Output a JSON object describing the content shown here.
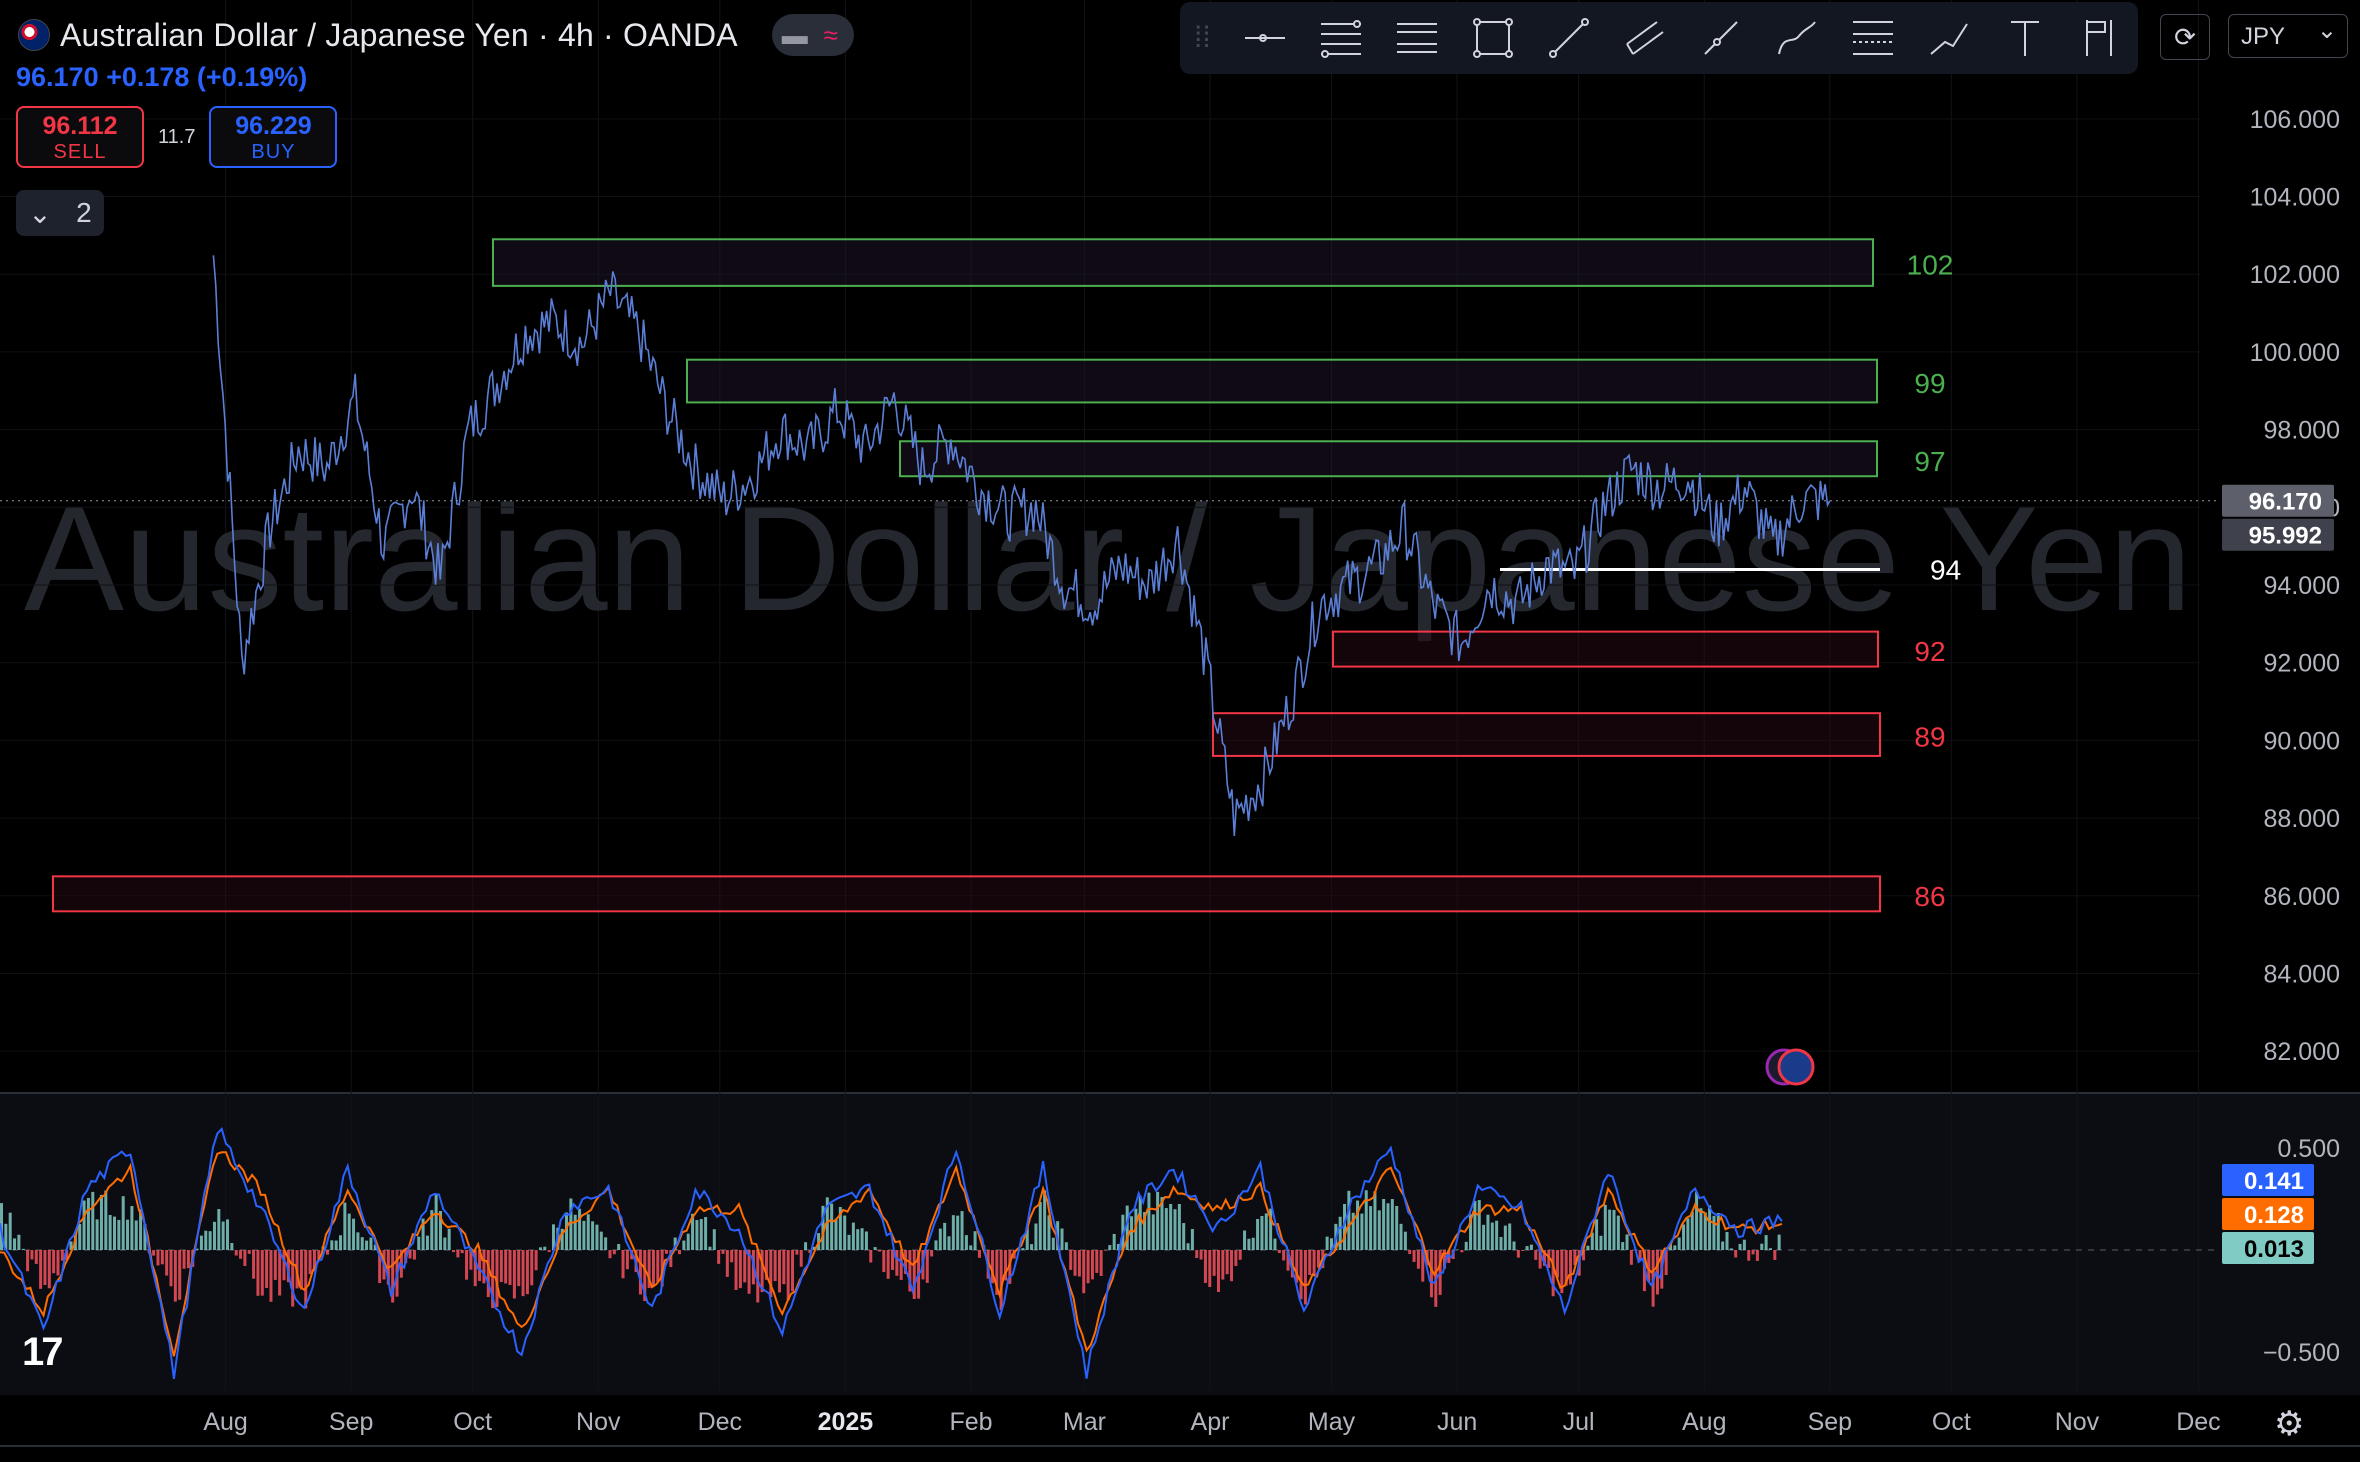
{
  "header": {
    "title": "Australian Dollar / Japanese Yen · 4h · OANDA",
    "quote": "96.170 +0.178 (+0.19%)",
    "sell_price": "96.112",
    "sell_label": "SELL",
    "spread": "11.7",
    "buy_price": "96.229",
    "buy_label": "BUY",
    "indicators_count": "2",
    "currency": "JPY"
  },
  "watermark": "Australian Dollar / Japanese Yen",
  "colors": {
    "price_line": "#5b7fd6",
    "supply_zone": "#4caf50",
    "demand_zone": "#f23645",
    "macd": "#2962ff",
    "signal": "#ff6d00",
    "hist_pos": "#80cbc4",
    "hist_neg": "#f7525f"
  },
  "chart_data": [
    {
      "type": "line",
      "title": "Australian Dollar / Japanese Yen · 4h · OANDA",
      "ylim": [
        81,
        107
      ],
      "y_ticks": [
        "106.000",
        "104.000",
        "102.000",
        "100.000",
        "98.000",
        "96.000",
        "94.000",
        "92.000",
        "90.000",
        "88.000",
        "86.000",
        "84.000",
        "82.000"
      ],
      "x_ticks": [
        "Aug",
        "Sep",
        "Oct",
        "Nov",
        "Dec",
        "2025",
        "Feb",
        "Mar",
        "Apr",
        "May",
        "Jun",
        "Jul",
        "Aug",
        "Sep",
        "Oct",
        "Nov",
        "Dec"
      ],
      "series": [
        {
          "x": [
            "2024-07-29",
            "2024-08-05",
            "2024-08-12",
            "2024-08-19",
            "2024-08-26",
            "2024-09-02",
            "2024-09-09",
            "2024-09-16",
            "2024-09-23",
            "2024-09-30",
            "2024-10-07",
            "2024-10-14",
            "2024-10-21",
            "2024-10-28",
            "2024-11-04",
            "2024-11-11",
            "2024-11-18",
            "2024-11-25",
            "2024-12-02",
            "2024-12-09",
            "2024-12-16",
            "2024-12-23",
            "2024-12-30",
            "2025-01-06",
            "2025-01-13",
            "2025-01-20",
            "2025-01-27",
            "2025-02-03",
            "2025-02-10",
            "2025-02-17",
            "2025-02-24",
            "2025-03-03",
            "2025-03-10",
            "2025-03-17",
            "2025-03-24",
            "2025-03-31",
            "2025-04-07",
            "2025-04-14",
            "2025-04-21",
            "2025-04-28",
            "2025-05-05",
            "2025-05-12",
            "2025-05-19",
            "2025-05-26",
            "2025-06-02",
            "2025-06-09",
            "2025-06-16",
            "2025-06-23",
            "2025-06-30",
            "2025-07-07",
            "2025-07-14",
            "2025-07-21",
            "2025-07-28",
            "2025-08-04",
            "2025-08-11",
            "2025-08-18",
            "2025-08-25",
            "2025-09-01"
          ],
          "values": [
            102.5,
            92.0,
            95.5,
            97.5,
            97.0,
            98.8,
            95.0,
            96.5,
            94.2,
            98.0,
            99.2,
            100.5,
            100.8,
            100.2,
            101.5,
            100.5,
            98.5,
            97.0,
            96.2,
            96.8,
            98.0,
            97.5,
            98.5,
            97.5,
            98.8,
            97.0,
            97.8,
            96.5,
            95.8,
            96.0,
            94.0,
            93.5,
            94.5,
            94.0,
            95.2,
            92.0,
            88.0,
            89.0,
            91.0,
            93.5,
            94.0,
            94.5,
            95.5,
            93.5,
            92.5,
            94.0,
            93.5,
            94.5,
            94.3,
            96.0,
            97.0,
            96.5,
            96.8,
            95.5,
            96.5,
            95.0,
            96.2,
            96.17
          ]
        }
      ],
      "zones": [
        {
          "label": "102",
          "low": 101.7,
          "high": 102.9,
          "color": "#4caf50"
        },
        {
          "label": "99",
          "low": 98.7,
          "high": 99.8,
          "color": "#4caf50"
        },
        {
          "label": "97",
          "low": 96.8,
          "high": 97.7,
          "color": "#4caf50"
        },
        {
          "label": "94",
          "level": 94.4,
          "color": "#ffffff"
        },
        {
          "label": "92",
          "low": 91.9,
          "high": 92.8,
          "color": "#f23645"
        },
        {
          "label": "89",
          "low": 89.6,
          "high": 90.7,
          "color": "#f23645"
        },
        {
          "label": "86",
          "low": 85.6,
          "high": 86.5,
          "color": "#f23645"
        }
      ],
      "price_labels": [
        "96.170",
        "95.992"
      ]
    },
    {
      "type": "line",
      "title": "",
      "ylim": [
        -0.7,
        0.75
      ],
      "y_ticks": [
        "0.500",
        "−0.500"
      ],
      "series": [
        {
          "name": "",
          "values": [
            0.1,
            -0.4,
            0.3,
            0.5,
            -0.6,
            0.6,
            0.2,
            -0.3,
            0.4,
            -0.2,
            0.3,
            -0.1,
            -0.5,
            0.2,
            0.3,
            -0.3,
            0.3,
            0.1,
            -0.4,
            0.2,
            0.3,
            -0.2,
            0.5,
            -0.3,
            0.4,
            -0.6,
            0.2,
            0.4,
            0.1,
            0.4,
            -0.3,
            0.2,
            0.5,
            -0.2,
            0.3,
            0.2,
            -0.3,
            0.4,
            -0.2,
            0.3,
            0.1,
            0.141
          ]
        },
        {
          "name": "",
          "values": [
            0.0,
            -0.3,
            0.2,
            0.4,
            -0.5,
            0.5,
            0.3,
            -0.2,
            0.3,
            -0.1,
            0.2,
            0.0,
            -0.4,
            0.1,
            0.3,
            -0.2,
            0.2,
            0.2,
            -0.3,
            0.1,
            0.3,
            -0.1,
            0.4,
            -0.2,
            0.3,
            -0.5,
            0.1,
            0.3,
            0.2,
            0.3,
            -0.2,
            0.1,
            0.4,
            -0.1,
            0.2,
            0.2,
            -0.2,
            0.3,
            -0.1,
            0.2,
            0.1,
            0.128
          ]
        }
      ],
      "price_labels": [
        "0.141",
        "0.128",
        "0.013"
      ]
    }
  ]
}
